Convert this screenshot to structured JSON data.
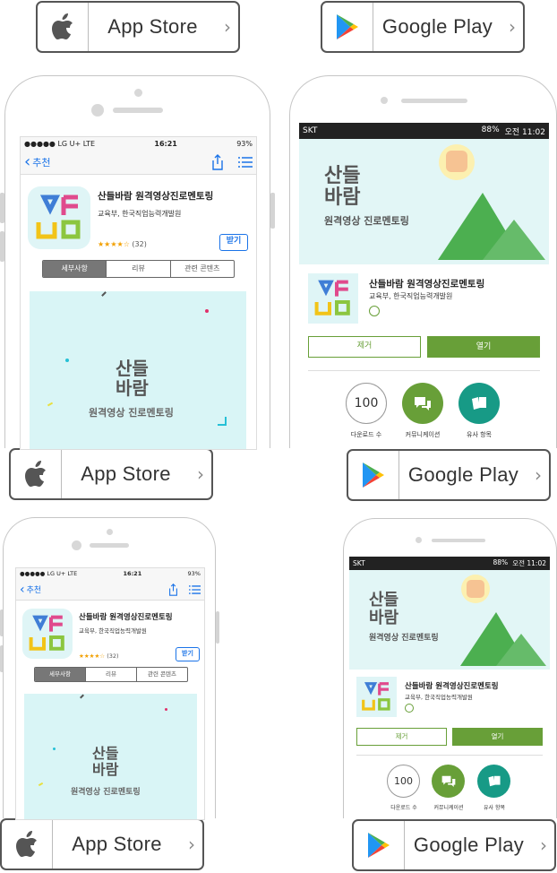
{
  "badges": {
    "app_store": "App Store",
    "google_play": "Google Play"
  },
  "ios": {
    "carrier": "●●●●● LG U+  LTE",
    "time": "16:21",
    "battery": "93%",
    "back_label": "추천",
    "app_title": "산들바람 원격영상진로멘토링",
    "developer": "교육부, 한국직업능력개발원",
    "rating_count": "(32)",
    "get_label": "받기",
    "tabs": [
      "세부사항",
      "리뷰",
      "관련 콘텐츠"
    ]
  },
  "android": {
    "carrier": "SKT",
    "battery": "88%",
    "time": "오전 11:02",
    "app_title": "산들바람 원격영상진로멘토링",
    "developer": "교육부, 한국직업능력개발원",
    "remove_label": "제거",
    "open_label": "열기",
    "downloads_value": "100",
    "downloads_label": "다운로드 수",
    "communication_label": "커뮤니케이션",
    "similar_label": "유사 항목"
  },
  "artwork": {
    "logo_line1": "산들",
    "logo_line2": "바람",
    "tagline": "원격영상 진로멘토링"
  },
  "colors": {
    "ios_blue": "#1a73e8",
    "play_green": "#689f38",
    "banner_bg": "#e2f6f6",
    "triangle_green": "#5cb85c"
  }
}
